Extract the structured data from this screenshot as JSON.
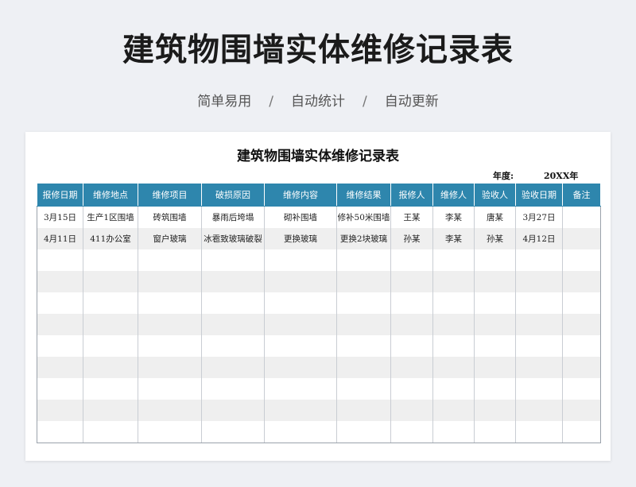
{
  "page": {
    "title": "建筑物围墙实体维修记录表",
    "subtitle_items": [
      "简单易用",
      "自动统计",
      "自动更新"
    ],
    "subtitle_separator": "/"
  },
  "sheet": {
    "title": "建筑物围墙实体维修记录表",
    "year_label": "年度:",
    "year_value": "20XX年"
  },
  "table": {
    "headers": [
      "报修日期",
      "维修地点",
      "维修项目",
      "破损原因",
      "维修内容",
      "维修结果",
      "报修人",
      "维修人",
      "验收人",
      "验收日期",
      "备注"
    ],
    "rows": [
      [
        "3月15日",
        "生产1区围墙",
        "砖筑围墙",
        "暴雨后垮塌",
        "砌补围墙",
        "修补50米围墙",
        "王某",
        "李某",
        "唐某",
        "3月27日",
        ""
      ],
      [
        "4月11日",
        "411办公室",
        "窗户玻璃",
        "冰雹致玻璃破裂",
        "更换玻璃",
        "更换2块玻璃",
        "孙某",
        "李某",
        "孙某",
        "4月12日",
        ""
      ],
      [
        "",
        "",
        "",
        "",
        "",
        "",
        "",
        "",
        "",
        "",
        ""
      ],
      [
        "",
        "",
        "",
        "",
        "",
        "",
        "",
        "",
        "",
        "",
        ""
      ],
      [
        "",
        "",
        "",
        "",
        "",
        "",
        "",
        "",
        "",
        "",
        ""
      ],
      [
        "",
        "",
        "",
        "",
        "",
        "",
        "",
        "",
        "",
        "",
        ""
      ],
      [
        "",
        "",
        "",
        "",
        "",
        "",
        "",
        "",
        "",
        "",
        ""
      ],
      [
        "",
        "",
        "",
        "",
        "",
        "",
        "",
        "",
        "",
        "",
        ""
      ],
      [
        "",
        "",
        "",
        "",
        "",
        "",
        "",
        "",
        "",
        "",
        ""
      ],
      [
        "",
        "",
        "",
        "",
        "",
        "",
        "",
        "",
        "",
        "",
        ""
      ],
      [
        "",
        "",
        "",
        "",
        "",
        "",
        "",
        "",
        "",
        "",
        ""
      ]
    ]
  },
  "colors": {
    "header_bg": "#2e86ad",
    "stripe": "#efefef"
  }
}
